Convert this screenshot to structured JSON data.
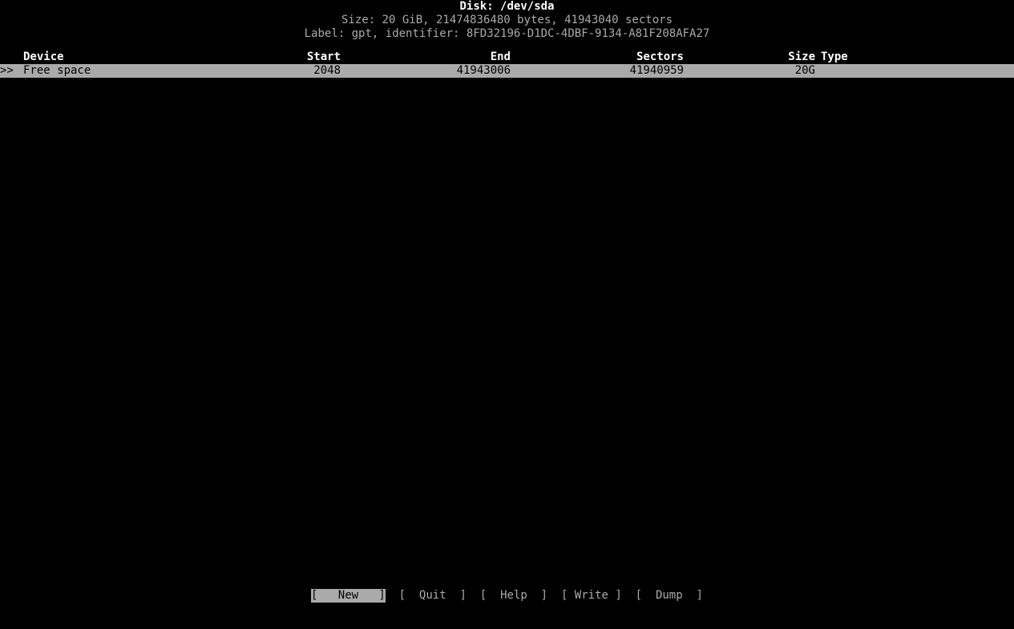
{
  "app": {
    "name": "cfdisk",
    "colors": {
      "background": "#000000",
      "foreground": "#aaaaaa",
      "bright_foreground": "#ffffff",
      "highlight_background": "#aaaaaa",
      "highlight_foreground": "#000000"
    }
  },
  "header": {
    "disk_title": "Disk: /dev/sda",
    "size_line": "Size: 20 GiB, 21474836480 bytes, 41943040 sectors",
    "label_line": "Label: gpt, identifier: 8FD32196-D1DC-4DBF-9134-A81F208AFA27"
  },
  "table": {
    "columns": [
      {
        "key": "device",
        "label": "Device"
      },
      {
        "key": "start",
        "label": "Start"
      },
      {
        "key": "end",
        "label": "End"
      },
      {
        "key": "sectors",
        "label": "Sectors"
      },
      {
        "key": "size",
        "label": "Size"
      },
      {
        "key": "type",
        "label": "Type"
      }
    ],
    "rows": [
      {
        "marker": ">>",
        "device": "Free space",
        "start": "2048",
        "end": "41943006",
        "sectors": "41940959",
        "size": "20G",
        "type": "",
        "selected": true
      }
    ]
  },
  "menu": {
    "items": [
      {
        "label": "New",
        "bracket_open": "[",
        "bracket_close": "]",
        "rendered": "[   New   ]",
        "active": true
      },
      {
        "label": "Quit",
        "bracket_open": "[",
        "bracket_close": "]",
        "rendered": "[  Quit  ]",
        "active": false
      },
      {
        "label": "Help",
        "bracket_open": "[",
        "bracket_close": "]",
        "rendered": "[  Help  ]",
        "active": false
      },
      {
        "label": "Write",
        "bracket_open": "[",
        "bracket_close": "]",
        "rendered": "[ Write ]",
        "active": false
      },
      {
        "label": "Dump",
        "bracket_open": "[",
        "bracket_close": "]",
        "rendered": "[  Dump  ]",
        "active": false
      }
    ],
    "separator": "  "
  }
}
